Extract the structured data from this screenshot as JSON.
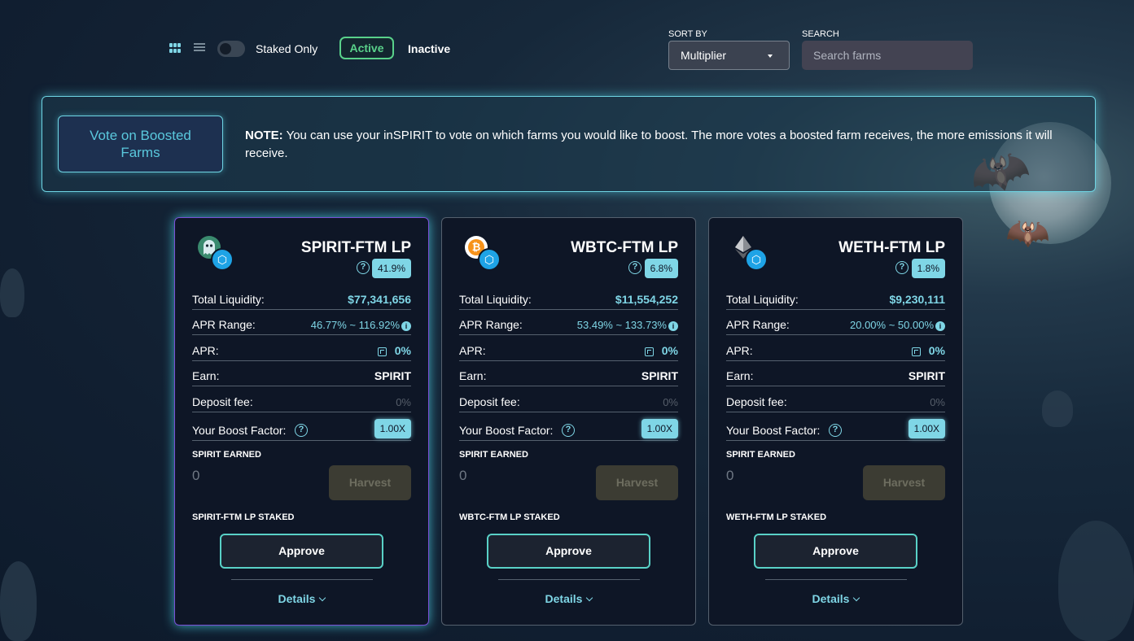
{
  "toolbar": {
    "staked_only_label": "Staked Only",
    "active_label": "Active",
    "inactive_label": "Inactive",
    "sort_by_label": "SORT BY",
    "sort_value": "Multiplier",
    "search_label": "SEARCH",
    "search_placeholder": "Search farms"
  },
  "banner": {
    "vote_button": "Vote on Boosted Farms",
    "note_prefix": "NOTE:",
    "note_text": " You can use your inSPIRIT to vote on which farms you would like to boost. The more votes a boosted farm receives, the more emissions it will receive."
  },
  "labels": {
    "total_liquidity": "Total Liquidity:",
    "apr_range": "APR Range:",
    "apr": "APR:",
    "earn": "Earn:",
    "deposit_fee": "Deposit fee:",
    "boost_factor": "Your Boost Factor:",
    "spirit_earned": "SPIRIT EARNED",
    "harvest": "Harvest",
    "approve": "Approve",
    "details": "Details"
  },
  "colors": {
    "accent": "#7fd6e6",
    "active_green": "#59d18a"
  },
  "farms": [
    {
      "name": "SPIRIT-FTM LP",
      "multiplier": "41.9%",
      "total_liquidity": "$77,341,656",
      "apr_range": "46.77% ~ 116.92%",
      "apr": "0%",
      "earn": "SPIRIT",
      "deposit_fee": "0%",
      "boost_factor": "1.00X",
      "earned": "0",
      "staked_label": "SPIRIT-FTM LP STAKED",
      "token_icon": "spirit-ghost-icon"
    },
    {
      "name": "WBTC-FTM LP",
      "multiplier": "6.8%",
      "total_liquidity": "$11,554,252",
      "apr_range": "53.49% ~ 133.73%",
      "apr": "0%",
      "earn": "SPIRIT",
      "deposit_fee": "0%",
      "boost_factor": "1.00X",
      "earned": "0",
      "staked_label": "WBTC-FTM LP STAKED",
      "token_icon": "bitcoin-icon"
    },
    {
      "name": "WETH-FTM LP",
      "multiplier": "1.8%",
      "total_liquidity": "$9,230,111",
      "apr_range": "20.00% ~ 50.00%",
      "apr": "0%",
      "earn": "SPIRIT",
      "deposit_fee": "0%",
      "boost_factor": "1.00X",
      "earned": "0",
      "staked_label": "WETH-FTM LP STAKED",
      "token_icon": "ethereum-icon"
    }
  ]
}
